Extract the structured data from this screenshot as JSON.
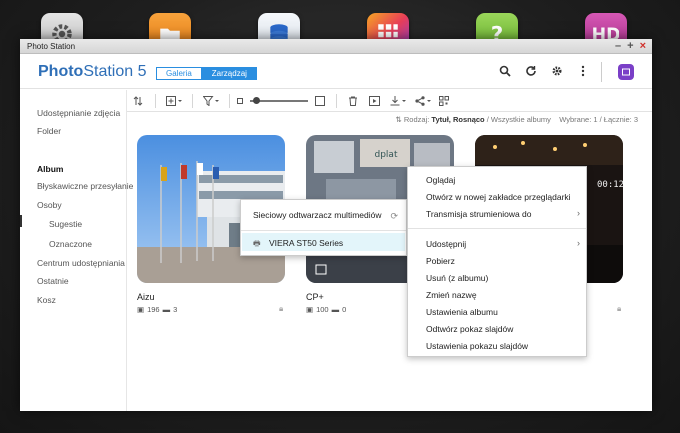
{
  "window": {
    "title": "Photo Station",
    "controls": [
      "–",
      "+",
      "×"
    ]
  },
  "dock": {
    "apps": [
      {
        "name": "settings",
        "color": "#cfcfcf"
      },
      {
        "name": "file-station",
        "color": "#f08a1c"
      },
      {
        "name": "backup",
        "color": "#e9eef5"
      },
      {
        "name": "app-center",
        "color": "#e83e58"
      },
      {
        "name": "help",
        "color": "#7cc53e"
      },
      {
        "name": "hd-station",
        "color": "#c03d9e"
      }
    ]
  },
  "header": {
    "logo_bold": "Photo",
    "logo_rest": "Station 5",
    "tabs": [
      {
        "label": "Galeria",
        "active": false
      },
      {
        "label": "Zarządzaj",
        "active": true
      }
    ],
    "icons": [
      "search-icon",
      "refresh-icon",
      "settings-icon",
      "more-icon"
    ]
  },
  "sidebar": {
    "items": [
      {
        "label": "Udostępnianie zdjęcia",
        "active": false,
        "sub": false
      },
      {
        "label": "Folder",
        "active": false,
        "sub": false
      },
      {
        "label": "Album",
        "active": true,
        "sub": false
      },
      {
        "label": "Błyskawiczne przesyłanie",
        "active": false,
        "sub": false
      },
      {
        "label": "Osoby",
        "active": false,
        "sub": false
      },
      {
        "label": "Sugestie",
        "active": false,
        "sub": true
      },
      {
        "label": "Oznaczone",
        "active": false,
        "sub": true
      },
      {
        "label": "Centrum udostępniania",
        "active": false,
        "sub": false
      },
      {
        "label": "Ostatnie",
        "active": false,
        "sub": false
      },
      {
        "label": "Kosz",
        "active": false,
        "sub": false
      }
    ]
  },
  "status": {
    "sort_label": "Rodzaj:",
    "sort_value": "Tytuł, Rosnąco",
    "path": "/ Wszystkie albumy",
    "selected": "Wybrane: 1",
    "total": "/ Łącznie: 3"
  },
  "albums": [
    {
      "name": "Aizu",
      "photos": "196",
      "videos": "3"
    },
    {
      "name": "CP+",
      "photos": "100",
      "videos": "0"
    },
    {
      "name": "",
      "photos": "",
      "videos": ""
    }
  ],
  "submenu": {
    "header": "Sieciowy odtwarzacz multimediów",
    "device": "VIERA ST50 Series"
  },
  "context_menu": {
    "items": [
      {
        "label": "Oglądaj",
        "arrow": false
      },
      {
        "label": "Otwórz w nowej zakładce przeglądarki",
        "arrow": false
      },
      {
        "label": "Transmisja strumieniowa do",
        "arrow": true
      },
      {
        "label": "Udostępnij",
        "arrow": true
      },
      {
        "label": "Pobierz",
        "arrow": false
      },
      {
        "label": "Usuń (z albumu)",
        "arrow": false
      },
      {
        "label": "Zmień nazwę",
        "arrow": false
      },
      {
        "label": "Ustawienia albumu",
        "arrow": false
      },
      {
        "label": "Odtwórz pokaz slajdów",
        "arrow": false
      },
      {
        "label": "Ustawienia pokazu slajdów",
        "arrow": false
      }
    ]
  },
  "overlay_text": "00:12"
}
